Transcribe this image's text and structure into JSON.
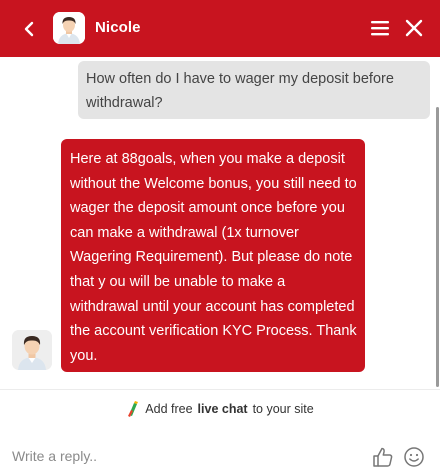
{
  "header": {
    "agent_name": "Nicole",
    "back_icon": "chevron-left-icon",
    "menu_icon": "hamburger-menu-icon",
    "close_icon": "close-icon",
    "brand_color": "#c8141f"
  },
  "messages": [
    {
      "from": "visitor",
      "text": "How often do I have to wager my deposit before withdrawal?"
    },
    {
      "from": "agent",
      "text": "Here at 88goals, when you make a deposit without the Welcome bonus, you still need to wager the deposit amount once before you can make a withdrawal (1x turnover Wagering Requirement). But please do note that y ou will be unable to make a withdrawal until your account has completed the account verification KYC Process. Thank you."
    }
  ],
  "promo": {
    "prefix": "Add free",
    "bold": "live chat",
    "suffix": "to your site"
  },
  "composer": {
    "placeholder": "Write a reply..",
    "thumb_icon": "thumbs-up-icon",
    "emoji_icon": "smiley-icon"
  }
}
